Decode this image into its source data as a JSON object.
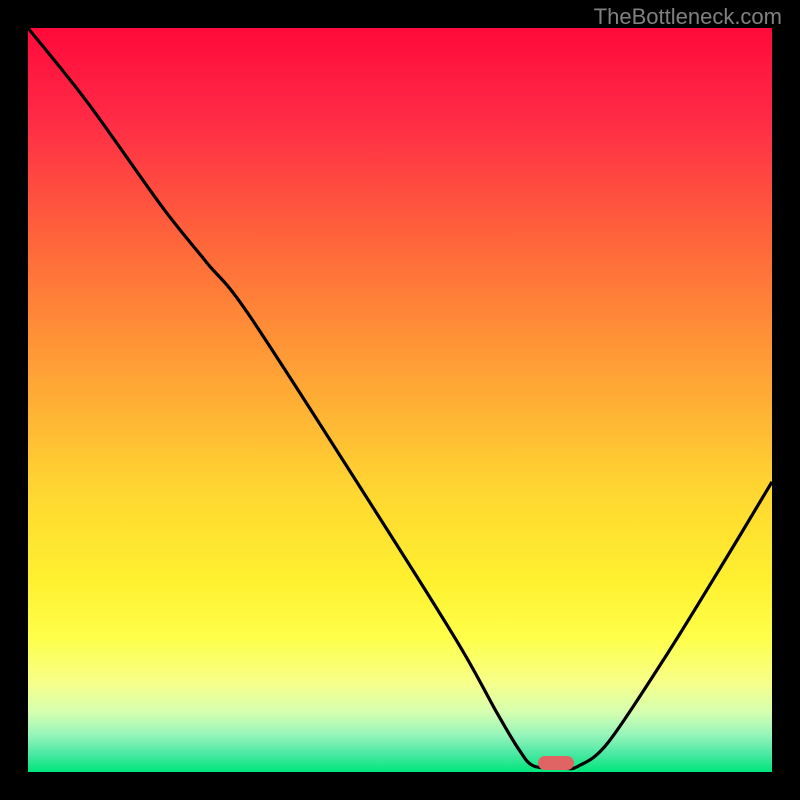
{
  "watermark": "TheBottleneck.com",
  "chart_data": {
    "type": "line",
    "title": "",
    "xlabel": "",
    "ylabel": "",
    "x_range": [
      0,
      100
    ],
    "y_range": [
      0,
      100
    ],
    "gradient_stops": [
      {
        "pos": 0,
        "color": "#ff0a3a"
      },
      {
        "pos": 12,
        "color": "#ff2a46"
      },
      {
        "pos": 30,
        "color": "#ff6a3a"
      },
      {
        "pos": 48,
        "color": "#ffa735"
      },
      {
        "pos": 62,
        "color": "#ffd631"
      },
      {
        "pos": 74,
        "color": "#fff02f"
      },
      {
        "pos": 82,
        "color": "#ffff4a"
      },
      {
        "pos": 88,
        "color": "#f7ff8a"
      },
      {
        "pos": 92,
        "color": "#d5ffb0"
      },
      {
        "pos": 95,
        "color": "#96f5ba"
      },
      {
        "pos": 97.5,
        "color": "#4de9a4"
      },
      {
        "pos": 100,
        "color": "#00e67a"
      }
    ],
    "series": [
      {
        "name": "bottleneck-curve",
        "color": "#000000",
        "points": [
          {
            "x": 0,
            "y": 100
          },
          {
            "x": 8,
            "y": 90
          },
          {
            "x": 18,
            "y": 76
          },
          {
            "x": 24,
            "y": 68.5
          },
          {
            "x": 30,
            "y": 61
          },
          {
            "x": 48,
            "y": 33
          },
          {
            "x": 58,
            "y": 17
          },
          {
            "x": 63,
            "y": 8
          },
          {
            "x": 66,
            "y": 3
          },
          {
            "x": 68,
            "y": 0.8
          },
          {
            "x": 72,
            "y": 0.5
          },
          {
            "x": 74,
            "y": 0.8
          },
          {
            "x": 78,
            "y": 4
          },
          {
            "x": 86,
            "y": 16
          },
          {
            "x": 94,
            "y": 29
          },
          {
            "x": 100,
            "y": 39
          }
        ]
      }
    ],
    "marker": {
      "x": 71,
      "y": 1.2
    }
  }
}
